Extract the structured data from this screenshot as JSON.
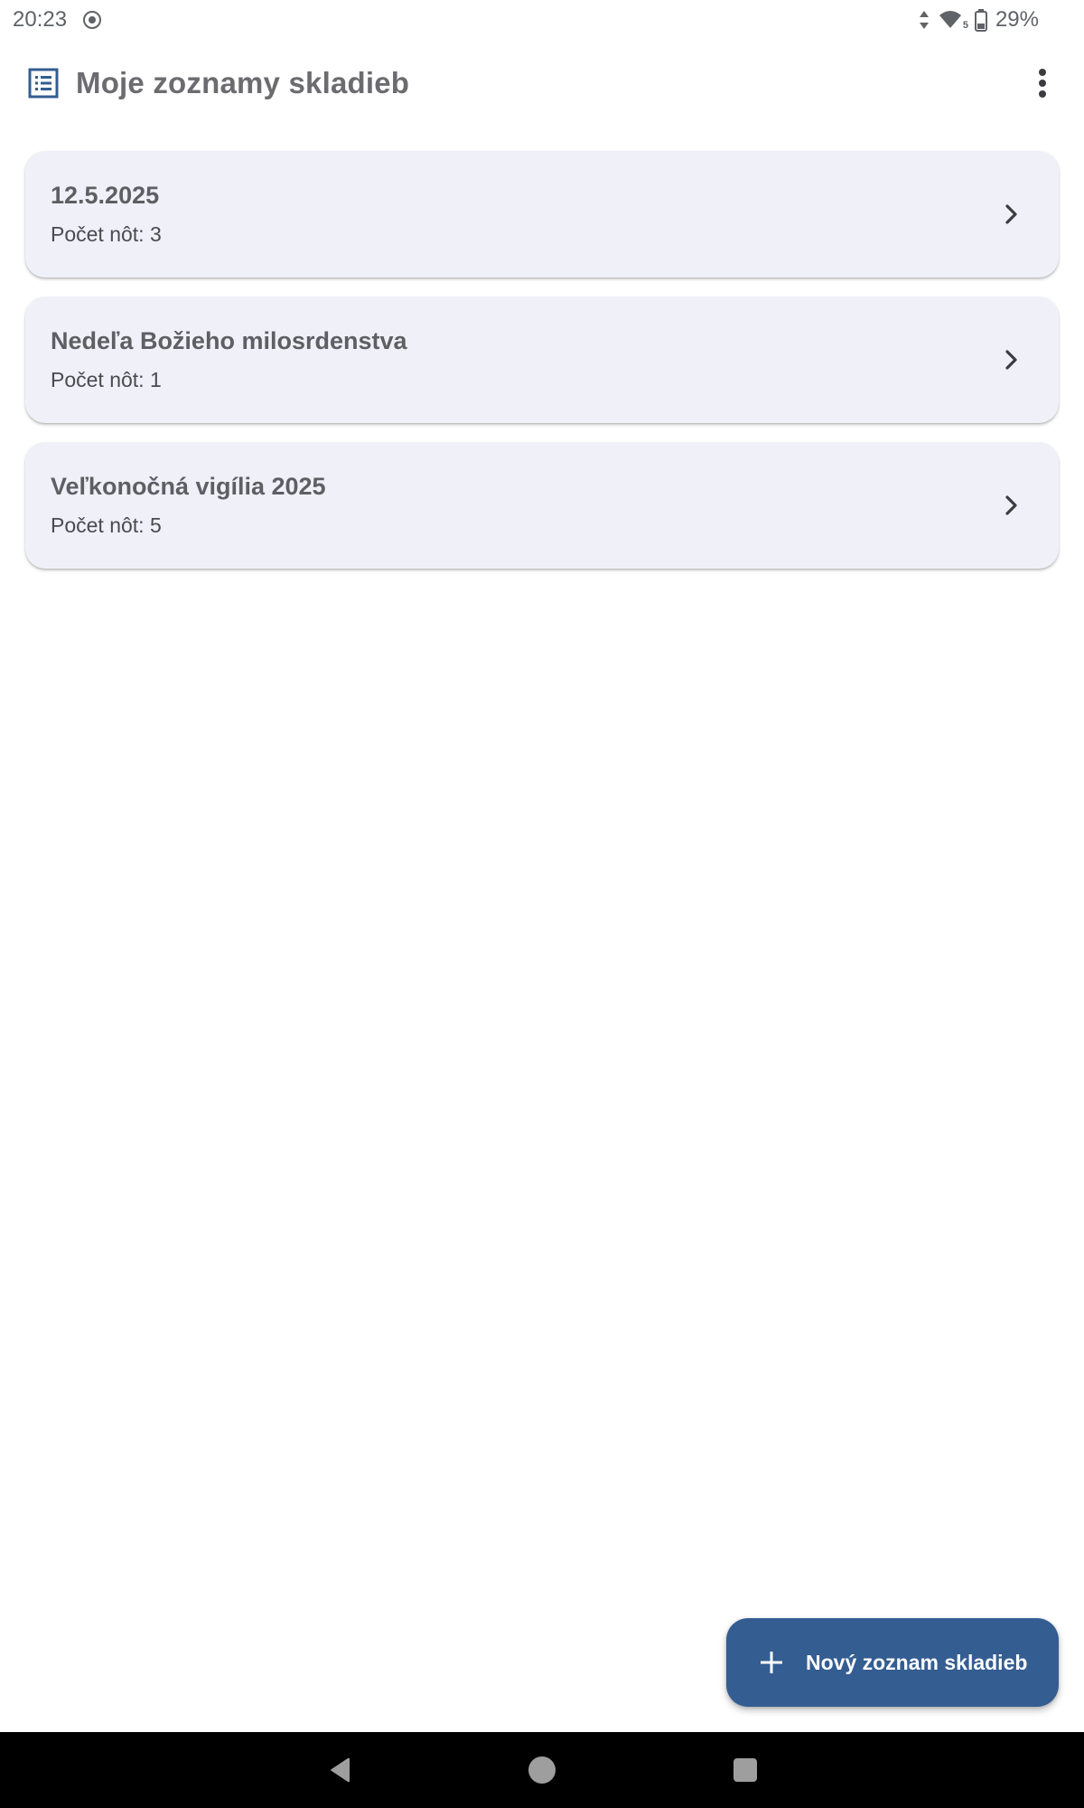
{
  "status_bar": {
    "time": "20:23",
    "battery": "29%",
    "network_badge": "5",
    "icons": [
      "screen-record-icon",
      "data-arrows-icon",
      "wifi-icon",
      "battery-icon"
    ]
  },
  "app_bar": {
    "title": "Moje zoznamy skladieb",
    "leading_icon": "list-icon",
    "menu_icon": "more-vert-icon"
  },
  "playlists": [
    {
      "title": "12.5.2025",
      "count_label": "Počet nôt: 3"
    },
    {
      "title": "Nedeľa Božieho milosrdenstva",
      "count_label": "Počet nôt: 1"
    },
    {
      "title": "Veľkonočná vigília 2025",
      "count_label": "Počet nôt: 5"
    }
  ],
  "fab": {
    "label": "Nový zoznam skladieb",
    "icon": "plus-icon"
  },
  "nav_bar": {
    "icons": [
      "back-icon",
      "home-icon",
      "recents-icon"
    ]
  },
  "colors": {
    "primary": "#345d91",
    "card_background": "#f0f1f8",
    "title_text": "#6b6b70",
    "nav_background": "#000000"
  }
}
